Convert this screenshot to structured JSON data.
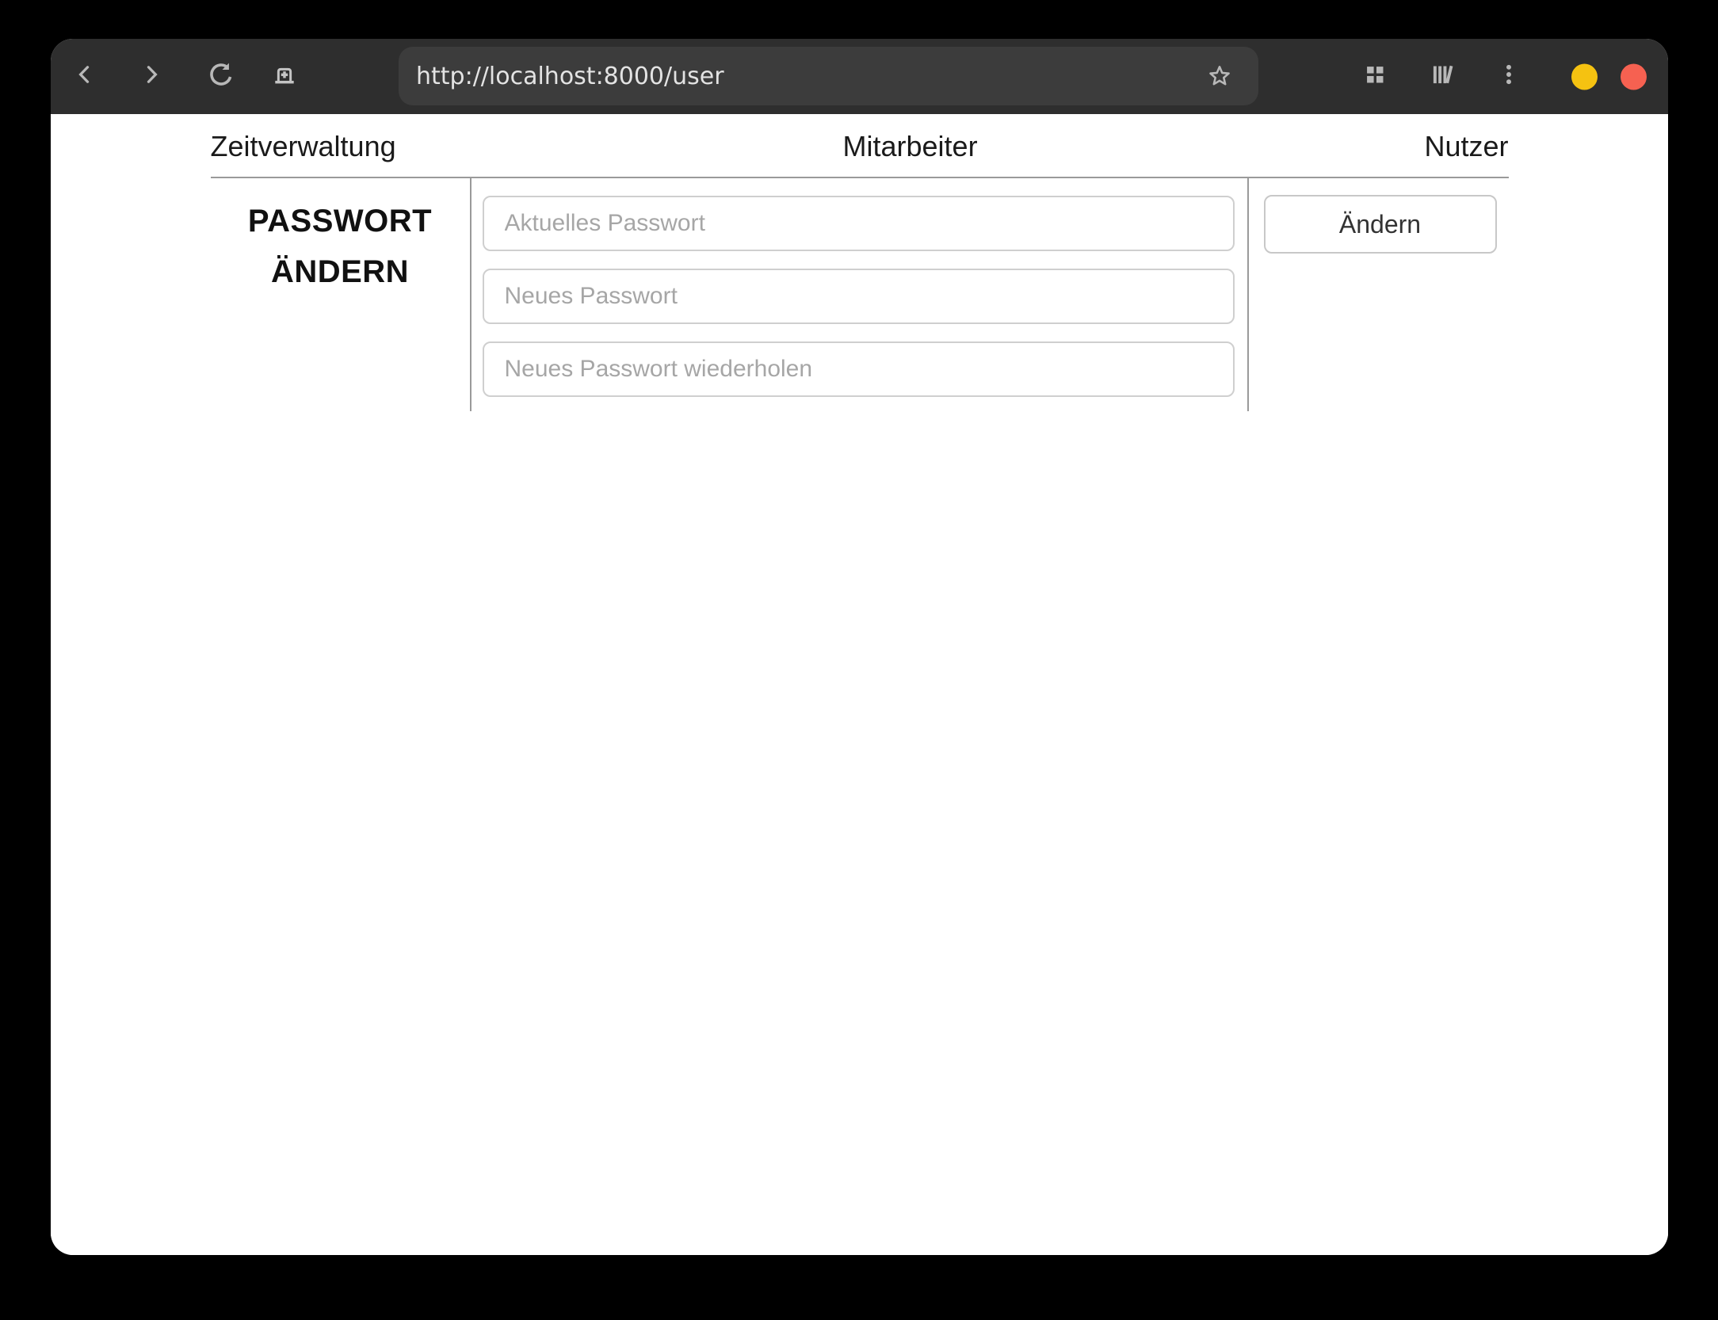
{
  "window": {
    "controls": [
      {
        "name": "minimize-button",
        "color": "#f5c211"
      },
      {
        "name": "close-button",
        "color": "#f66151"
      }
    ]
  },
  "browser": {
    "url": "http://localhost:8000/user",
    "toolbar_icons": [
      "back-icon",
      "forward-icon",
      "reload-icon",
      "new-tab-icon",
      "bookmark-star-icon",
      "tab-grid-icon",
      "library-icon",
      "kebab-menu-icon"
    ]
  },
  "nav": {
    "items": [
      {
        "label": "Zeitverwaltung"
      },
      {
        "label": "Mitarbeiter"
      },
      {
        "label": "Nutzer"
      }
    ]
  },
  "form": {
    "heading": {
      "line1": "PASSWORT",
      "line2": "ÄNDERN"
    },
    "fields": [
      {
        "placeholder": "Aktuelles Passwort",
        "value": ""
      },
      {
        "placeholder": "Neues Passwort",
        "value": ""
      },
      {
        "placeholder": "Neues Passwort wiederholen",
        "value": ""
      }
    ],
    "submit": {
      "label": "Ändern"
    }
  },
  "colors": {
    "outer_bg": "#000000",
    "titlebar_bg": "#2e2e2e",
    "urlbar_bg": "#3c3c3c",
    "icon_gray": "#b8b8b8",
    "minimize_yellow": "#f5c211",
    "close_red": "#f66151",
    "page_bg": "#ffffff",
    "table_border": "#9a9a9a",
    "input_border": "#cfcfcf",
    "placeholder_gray": "#a6a6a6",
    "text_dark": "#1a1a1a"
  }
}
